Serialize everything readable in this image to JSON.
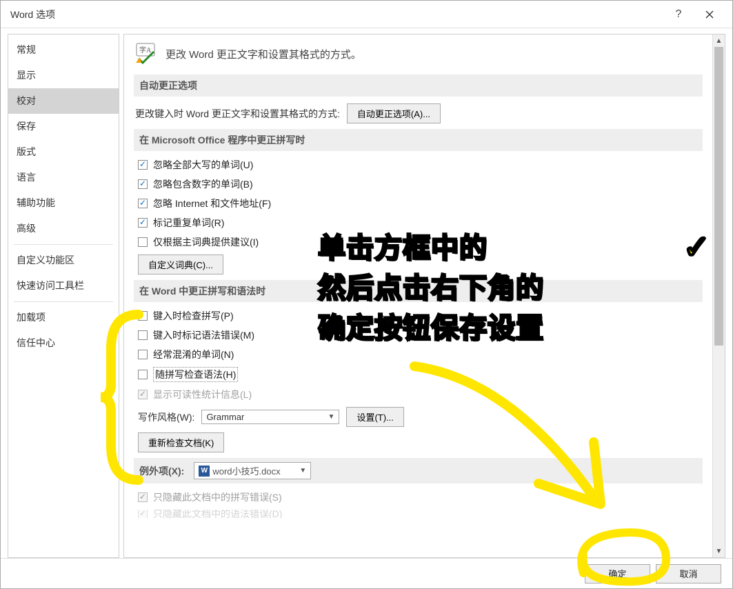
{
  "window": {
    "title": "Word 选项"
  },
  "sidebar": {
    "items": [
      {
        "label": "常规"
      },
      {
        "label": "显示"
      },
      {
        "label": "校对",
        "selected": true
      },
      {
        "label": "保存"
      },
      {
        "label": "版式"
      },
      {
        "label": "语言"
      },
      {
        "label": "辅助功能"
      },
      {
        "label": "高级"
      }
    ],
    "items2": [
      {
        "label": "自定义功能区"
      },
      {
        "label": "快速访问工具栏"
      }
    ],
    "items3": [
      {
        "label": "加载项"
      },
      {
        "label": "信任中心"
      }
    ]
  },
  "header_text": "更改 Word 更正文字和设置其格式的方式。",
  "section1": {
    "title": "自动更正选项",
    "desc": "更改键入时 Word 更正文字和设置其格式的方式:",
    "btn": "自动更正选项(A)..."
  },
  "section2": {
    "title": "在 Microsoft Office 程序中更正拼写时",
    "opts": [
      {
        "label": "忽略全部大写的单词(U)",
        "checked": true
      },
      {
        "label": "忽略包含数字的单词(B)",
        "checked": true
      },
      {
        "label": "忽略 Internet 和文件地址(F)",
        "checked": true
      },
      {
        "label": "标记重复单词(R)",
        "checked": true
      },
      {
        "label": "仅根据主词典提供建议(I)",
        "checked": false
      }
    ],
    "btn": "自定义词典(C)..."
  },
  "section3": {
    "title": "在 Word 中更正拼写和语法时",
    "opts": [
      {
        "label": "键入时检查拼写(P)",
        "checked": false
      },
      {
        "label": "键入时标记语法错误(M)",
        "checked": false
      },
      {
        "label": "经常混淆的单词(N)",
        "checked": false
      },
      {
        "label": "随拼写检查语法(H)",
        "checked": false,
        "boxed": true
      },
      {
        "label": "显示可读性统计信息(L)",
        "checked": true,
        "disabled": true
      }
    ],
    "style_label": "写作风格(W):",
    "style_value": "Grammar",
    "settings_btn": "设置(T)...",
    "recheck_btn": "重新检查文档(K)"
  },
  "section4": {
    "title_label": "例外项(X):",
    "doc_name": "word小技巧.docx",
    "opts": [
      {
        "label": "只隐藏此文档中的拼写错误(S)",
        "checked": true,
        "disabled": true
      },
      {
        "label": "只隐藏此文档中的语法错误(D)",
        "checked": true,
        "disabled": true,
        "cut": true
      }
    ]
  },
  "footer": {
    "ok": "确定",
    "cancel": "取消"
  },
  "annotation": {
    "line1": "单击方框中的",
    "line2": "然后点击右下角的",
    "line3": "确定按钮保存设置"
  }
}
